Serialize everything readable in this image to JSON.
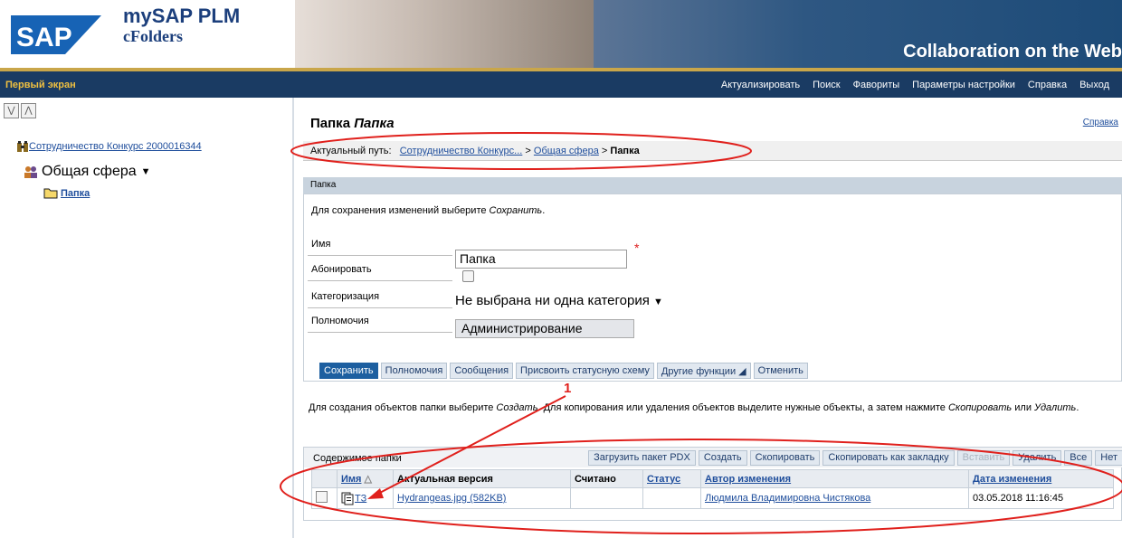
{
  "header": {
    "logo_text": "SAP",
    "app_title": "mySAP PLM",
    "app_subtitle": "cFolders",
    "tagline": "Collaboration on the Web"
  },
  "topbar": {
    "home": "Первый экран",
    "nav": [
      "Актуализировать",
      "Поиск",
      "Фавориты",
      "Параметры настройки",
      "Справка",
      "Выход"
    ]
  },
  "tree": {
    "root": "Сотрудничество Конкурс 2000016344",
    "space": "Общая сфера",
    "space_caret": "▼",
    "folder": "Папка"
  },
  "page": {
    "title_prefix": "Папка",
    "title_name": "Папка",
    "help": "Справка",
    "path_label": "Актуальный путь:",
    "path_items": [
      "Сотрудничество Конкурс...",
      "Общая сфера"
    ],
    "path_sep": ">",
    "path_current": "Папка"
  },
  "panel": {
    "header": "Папка",
    "hint_prefix": "Для сохранения изменений выберите ",
    "hint_italic": "Сохранить",
    "hint_suffix": ".",
    "fields": {
      "name_label": "Имя",
      "name_value": "Папка",
      "required": "*",
      "subscribe_label": "Абонировать",
      "category_label": "Категоризация",
      "category_value": "Не выбрана ни одна категория",
      "category_caret": "▼",
      "permissions_label": "Полномочия",
      "permissions_value": "Администрирование"
    },
    "buttons": [
      "Сохранить",
      "Полномочия",
      "Сообщения",
      "Присвоить статусную схему",
      "Другие функции ◢",
      "Отменить"
    ]
  },
  "create_hint": {
    "p1": "Для создания объектов папки выберите ",
    "i1": "Создать",
    "p2": ". Для копирования или удаления объектов выделите нужные объекты, а затем нажмите ",
    "i2": "Скопировать",
    "p3": " или ",
    "i3": "Удалить",
    "p4": "."
  },
  "contents": {
    "title": "Содержимое папки",
    "actions": [
      {
        "label": "Загрузить пакет PDX",
        "enabled": true
      },
      {
        "label": "Создать",
        "enabled": true
      },
      {
        "label": "Скопировать",
        "enabled": true
      },
      {
        "label": "Скопировать как закладку",
        "enabled": true
      },
      {
        "label": "Вставить",
        "enabled": false
      },
      {
        "label": "Удалить",
        "enabled": true
      },
      {
        "label": "Все",
        "enabled": true
      },
      {
        "label": "Нет",
        "enabled": true
      }
    ],
    "columns": [
      "Имя",
      "Актуальная версия",
      "Считано",
      "Статус",
      "Автор изменения",
      "Дата изменения"
    ],
    "sort_indicator": "△",
    "rows": [
      {
        "name": "ТЗ",
        "version": "Hydrangeas.jpg (582KB)",
        "read": "",
        "status": "",
        "author": "Людмила Владимировна Чистякова",
        "date": "03.05.2018 11:16:45"
      }
    ]
  },
  "annotation": {
    "label": "1",
    "color": "#e0201c"
  }
}
